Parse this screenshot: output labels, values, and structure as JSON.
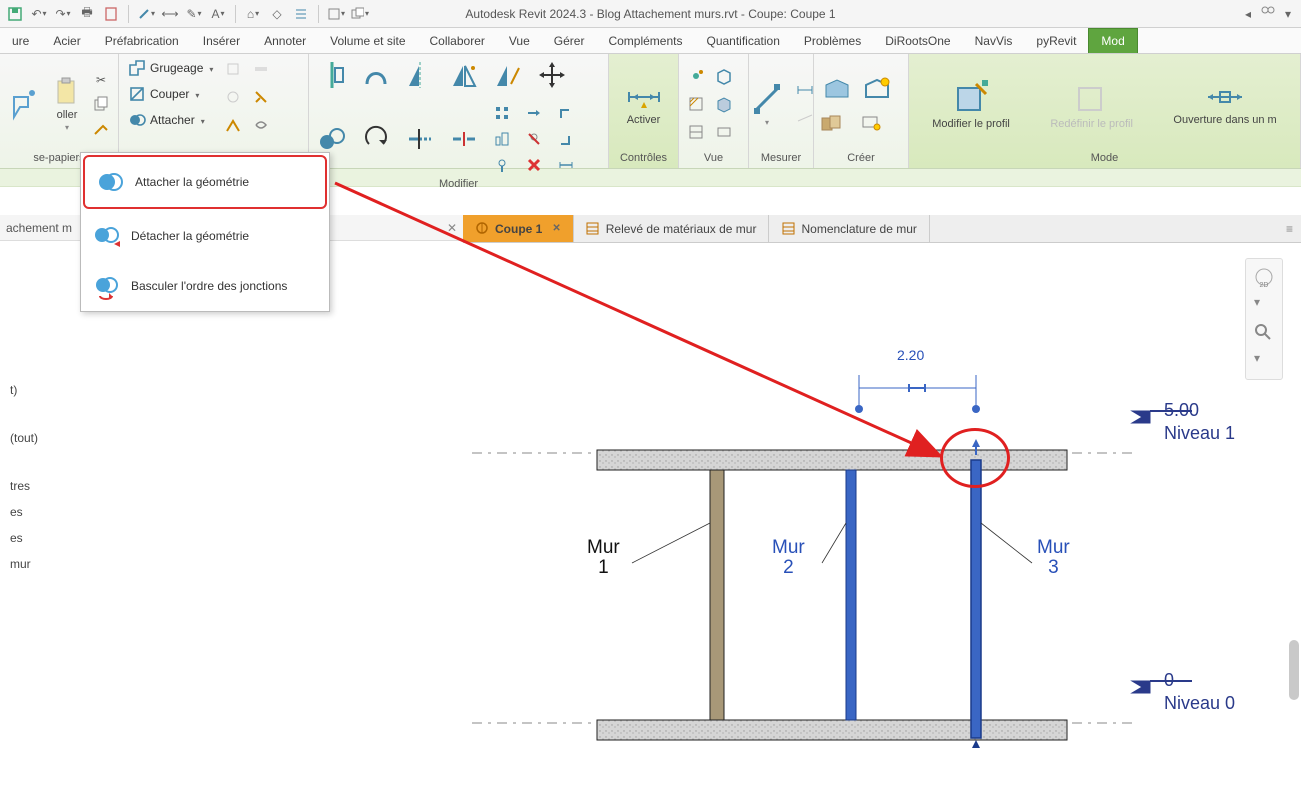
{
  "app": {
    "title": "Autodesk Revit 2024.3 - Blog Attachement murs.rvt - Coupe: Coupe 1"
  },
  "menutabs": [
    "ure",
    "Acier",
    "Préfabrication",
    "Insérer",
    "Annoter",
    "Volume et site",
    "Collaborer",
    "Vue",
    "Gérer",
    "Compléments",
    "Quantification",
    "Problèmes",
    "DiRootsOne",
    "NavVis",
    "pyRevit",
    "Mod"
  ],
  "ribbon": {
    "panels": {
      "presse": {
        "label": "se-papiers",
        "oller": "oller"
      },
      "geometry": {
        "grugeage": "Grugeage",
        "couper": "Couper",
        "attacher": "Attacher"
      },
      "modifier": {
        "label": "Modifier"
      },
      "controles": {
        "label": "Contrôles",
        "activer": "Activer"
      },
      "vue": {
        "label": "Vue"
      },
      "mesurer": {
        "label": "Mesurer"
      },
      "creer": {
        "label": "Créer"
      },
      "mode": {
        "label": "Mode",
        "modifier_profil": "Modifier le profil",
        "redef": "Redéfinir le profil",
        "ouverture": "Ouverture dans un m"
      }
    }
  },
  "dropdown": {
    "attach": "Attacher la géométrie",
    "detach": "Détacher la géométrie",
    "basculer": "Basculer l'ordre des jonctions"
  },
  "leftpane": {
    "header": "achement m",
    "lines": [
      "t)",
      "(tout)",
      "tres",
      "es",
      "es",
      "mur"
    ]
  },
  "viewtabs": {
    "t1": "Coupe 1",
    "t2": "Relevé de matériaux de mur",
    "t3": "Nomenclature de mur"
  },
  "canvas": {
    "dim": "2.20",
    "level_top_val": "5.00",
    "level_top_name": "Niveau 1",
    "level_bot_val": "0",
    "level_bot_name": "Niveau 0",
    "mur1a": "Mur",
    "mur1b": "1",
    "mur2a": "Mur",
    "mur2b": "2",
    "mur3a": "Mur",
    "mur3b": "3"
  }
}
